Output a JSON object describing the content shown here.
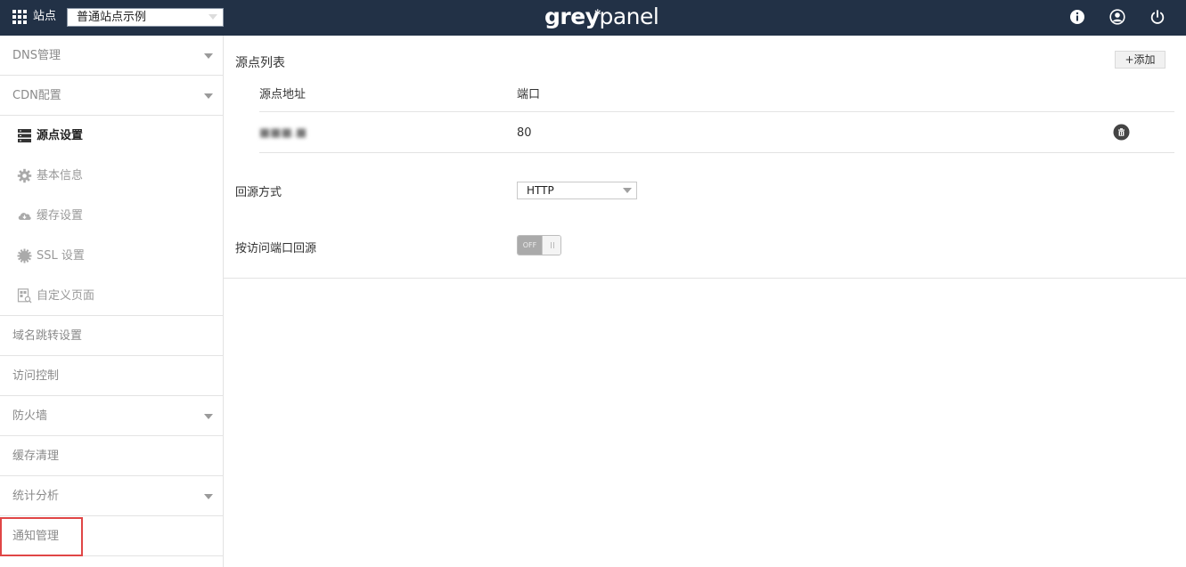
{
  "topbar": {
    "site_label": "站点",
    "site_select_value": "普通站点示例",
    "logo_bold": "grey",
    "logo_light": "panel",
    "logo_spark": "✻"
  },
  "sidebar": {
    "items": [
      {
        "label": "DNS管理"
      },
      {
        "label": "CDN配置"
      },
      {
        "label": "域名跳转设置"
      },
      {
        "label": "访问控制"
      },
      {
        "label": "防火墙"
      },
      {
        "label": "缓存清理"
      },
      {
        "label": "统计分析"
      },
      {
        "label": "通知管理"
      }
    ],
    "sub_items": [
      {
        "label": "源点设置"
      },
      {
        "label": "基本信息"
      },
      {
        "label": "缓存设置"
      },
      {
        "label": "SSL 设置"
      },
      {
        "label": "自定义页面"
      }
    ]
  },
  "main": {
    "section_title": "源点列表",
    "add_button": "+添加",
    "columns": [
      "源点地址",
      "端口"
    ],
    "rows": [
      {
        "address": "■■■.■",
        "port": "80"
      }
    ],
    "origin_method_label": "回源方式",
    "origin_method_value": "HTTP",
    "port_origin_label": "按访问端口回源",
    "toggle_text": "OFF",
    "toggle_state": "off"
  },
  "colors": {
    "topbar_bg": "#223146",
    "highlight": "#e04646"
  }
}
